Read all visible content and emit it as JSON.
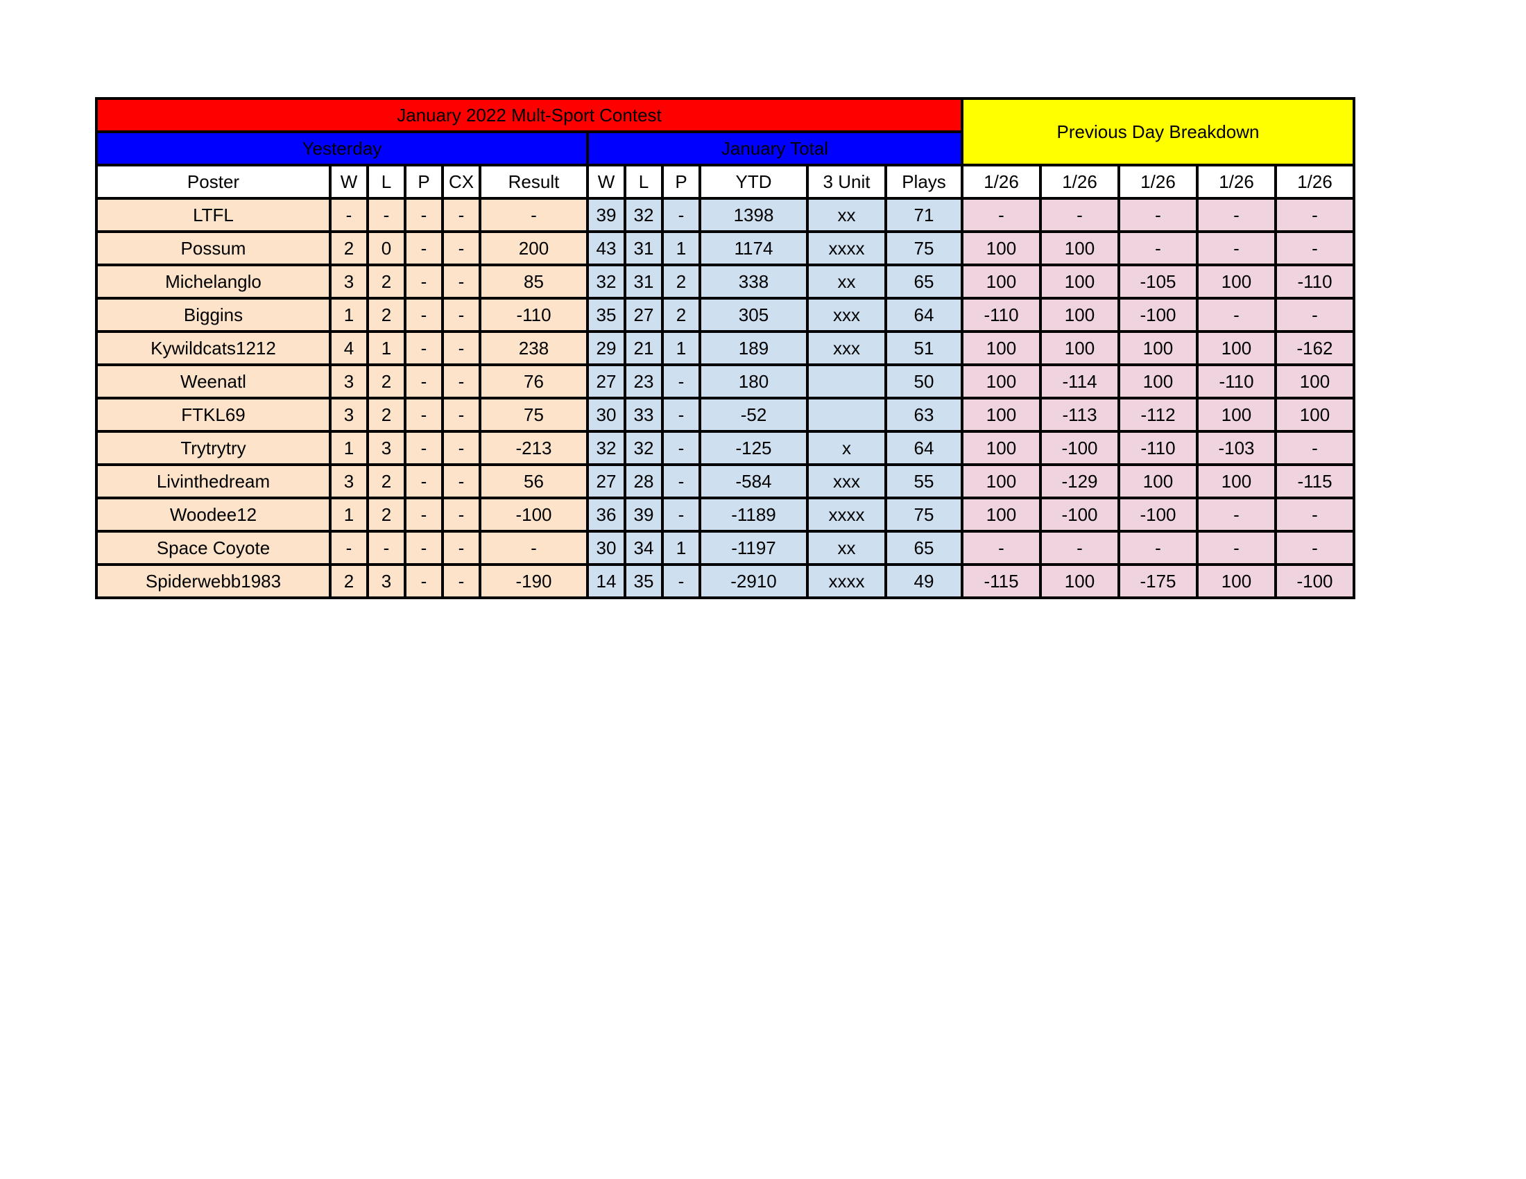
{
  "banners": {
    "title": "January 2022 Mult-Sport Contest",
    "yesterday": "Yesterday",
    "january_total": "January Total",
    "previous_day_breakdown": "Previous Day Breakdown"
  },
  "colors": {
    "title_bg": "#FF0000",
    "group_bg": "#0000FF",
    "breakdown_bg": "#FFFF00",
    "yesterday_cell": "#FCE3C9",
    "total_cell": "#CEDFF0",
    "breakdown_cell": "#EFD3DE",
    "border": "#000000"
  },
  "headers": {
    "poster": "Poster",
    "yesterday": [
      "W",
      "L",
      "P",
      "CX",
      "Result"
    ],
    "total": [
      "W",
      "L",
      "P",
      "YTD",
      "3 Unit",
      "Plays"
    ],
    "breakdown": [
      "1/26",
      "1/26",
      "1/26",
      "1/26",
      "1/26"
    ]
  },
  "rows": [
    {
      "poster": "LTFL",
      "yesterday": [
        "-",
        "-",
        "-",
        "-",
        "-"
      ],
      "total": [
        "39",
        "32",
        "-",
        "1398",
        "xx",
        "71"
      ],
      "breakdown": [
        "-",
        "-",
        "-",
        "-",
        "-"
      ]
    },
    {
      "poster": "Possum",
      "yesterday": [
        "2",
        "0",
        "-",
        "-",
        "200"
      ],
      "total": [
        "43",
        "31",
        "1",
        "1174",
        "xxxx",
        "75"
      ],
      "breakdown": [
        "100",
        "100",
        "-",
        "-",
        "-"
      ]
    },
    {
      "poster": "Michelanglo",
      "yesterday": [
        "3",
        "2",
        "-",
        "-",
        "85"
      ],
      "total": [
        "32",
        "31",
        "2",
        "338",
        "xx",
        "65"
      ],
      "breakdown": [
        "100",
        "100",
        "-105",
        "100",
        "-110"
      ]
    },
    {
      "poster": "Biggins",
      "yesterday": [
        "1",
        "2",
        "-",
        "-",
        "-110"
      ],
      "total": [
        "35",
        "27",
        "2",
        "305",
        "xxx",
        "64"
      ],
      "breakdown": [
        "-110",
        "100",
        "-100",
        "-",
        "-"
      ]
    },
    {
      "poster": "Kywildcats1212",
      "yesterday": [
        "4",
        "1",
        "-",
        "-",
        "238"
      ],
      "total": [
        "29",
        "21",
        "1",
        "189",
        "xxx",
        "51"
      ],
      "breakdown": [
        "100",
        "100",
        "100",
        "100",
        "-162"
      ]
    },
    {
      "poster": "Weenatl",
      "yesterday": [
        "3",
        "2",
        "-",
        "-",
        "76"
      ],
      "total": [
        "27",
        "23",
        "-",
        "180",
        "",
        "50"
      ],
      "breakdown": [
        "100",
        "-114",
        "100",
        "-110",
        "100"
      ]
    },
    {
      "poster": "FTKL69",
      "yesterday": [
        "3",
        "2",
        "-",
        "-",
        "75"
      ],
      "total": [
        "30",
        "33",
        "-",
        "-52",
        "",
        "63"
      ],
      "breakdown": [
        "100",
        "-113",
        "-112",
        "100",
        "100"
      ]
    },
    {
      "poster": "Trytrytry",
      "yesterday": [
        "1",
        "3",
        "-",
        "-",
        "-213"
      ],
      "total": [
        "32",
        "32",
        "-",
        "-125",
        "x",
        "64"
      ],
      "breakdown": [
        "100",
        "-100",
        "-110",
        "-103",
        "-"
      ]
    },
    {
      "poster": "Livinthedream",
      "yesterday": [
        "3",
        "2",
        "-",
        "-",
        "56"
      ],
      "total": [
        "27",
        "28",
        "-",
        "-584",
        "xxx",
        "55"
      ],
      "breakdown": [
        "100",
        "-129",
        "100",
        "100",
        "-115"
      ]
    },
    {
      "poster": "Woodee12",
      "yesterday": [
        "1",
        "2",
        "-",
        "-",
        "-100"
      ],
      "total": [
        "36",
        "39",
        "-",
        "-1189",
        "xxxx",
        "75"
      ],
      "breakdown": [
        "100",
        "-100",
        "-100",
        "-",
        "-"
      ]
    },
    {
      "poster": "Space Coyote",
      "yesterday": [
        "-",
        "-",
        "-",
        "-",
        "-"
      ],
      "total": [
        "30",
        "34",
        "1",
        "-1197",
        "xx",
        "65"
      ],
      "breakdown": [
        "-",
        "-",
        "-",
        "-",
        "-"
      ]
    },
    {
      "poster": "Spiderwebb1983",
      "yesterday": [
        "2",
        "3",
        "-",
        "-",
        "-190"
      ],
      "total": [
        "14",
        "35",
        "-",
        "-2910",
        "xxxx",
        "49"
      ],
      "breakdown": [
        "-115",
        "100",
        "-175",
        "100",
        "-100"
      ]
    }
  ]
}
